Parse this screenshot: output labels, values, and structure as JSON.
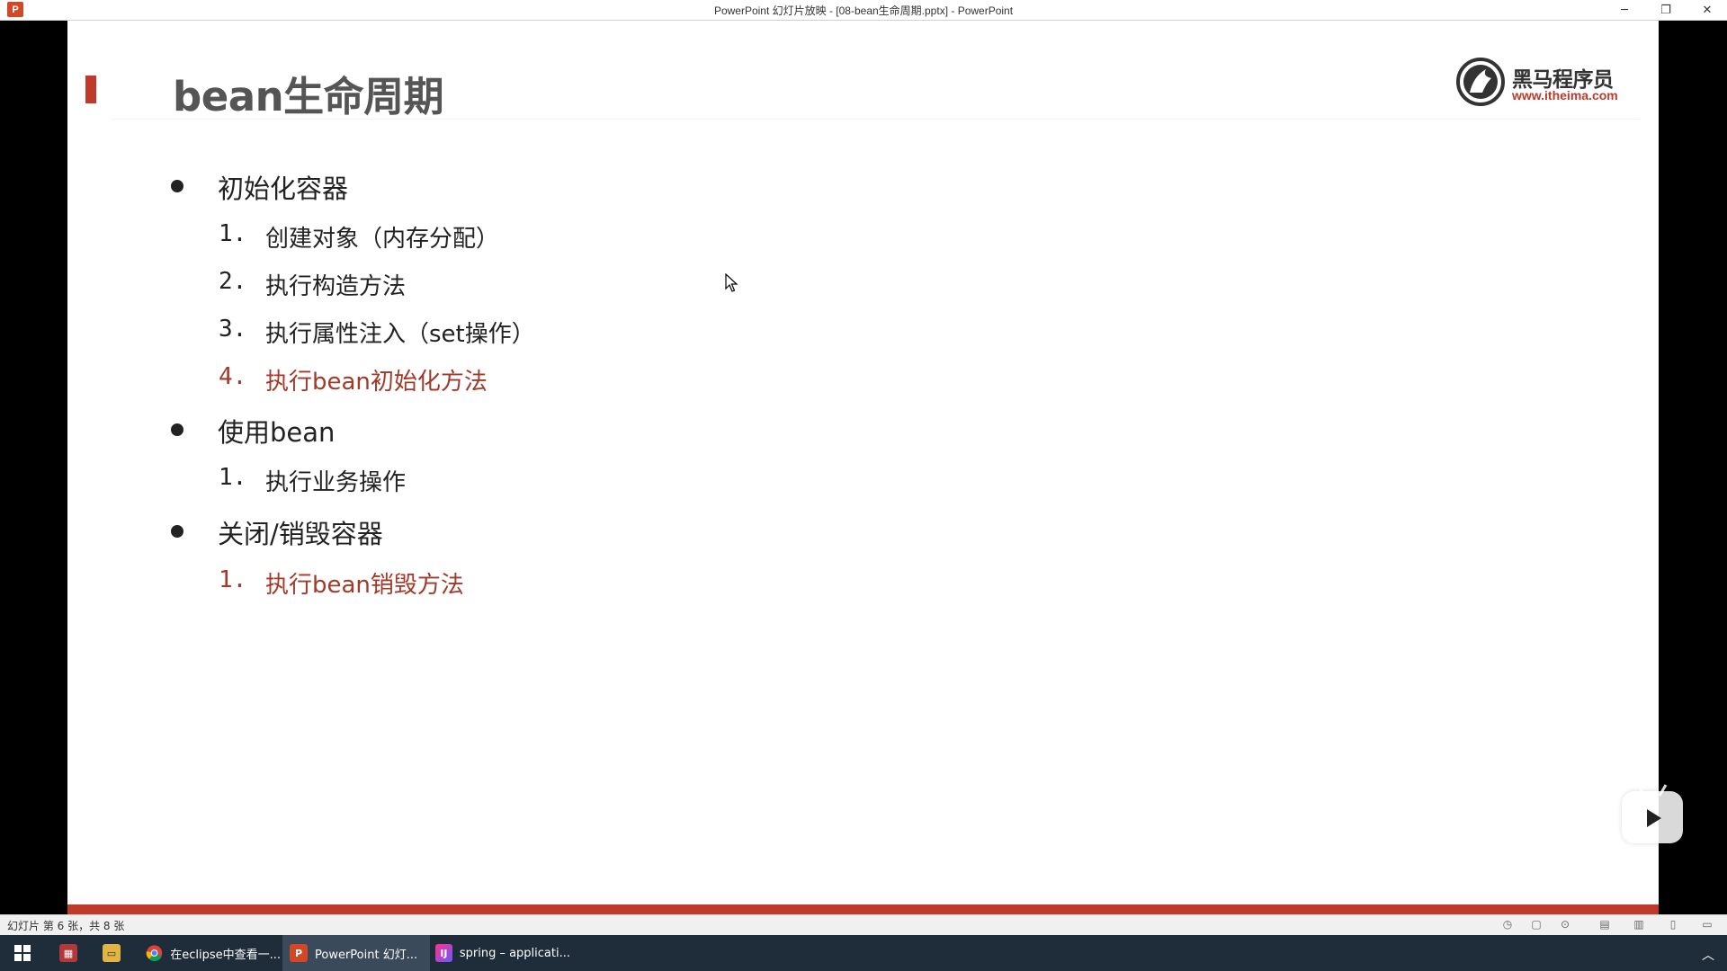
{
  "window": {
    "app_icon": "P",
    "title": "PowerPoint 幻灯片放映 - [08-bean生命周期.pptx] - PowerPoint",
    "buttons": {
      "minimize": "─",
      "restore": "❐",
      "close": "✕"
    }
  },
  "slide": {
    "title": "bean生命周期",
    "logo": {
      "brand": "黑马程序员",
      "url": "www.itheima.com"
    },
    "sections": [
      {
        "label": "初始化容器",
        "steps": [
          {
            "num": "1.",
            "text": "创建对象（内存分配）"
          },
          {
            "num": "2.",
            "text": "执行构造方法"
          },
          {
            "num": "3.",
            "text": "执行属性注入（set操作）"
          },
          {
            "num": "4.",
            "text": "执行bean初始化方法"
          }
        ]
      },
      {
        "label": "使用bean",
        "steps": [
          {
            "num": "1.",
            "text": "执行业务操作"
          }
        ]
      },
      {
        "label": "关闭/销毁容器",
        "steps": [
          {
            "num": "1.",
            "text": "执行bean销毁方法"
          }
        ]
      }
    ]
  },
  "statusbar": {
    "text": "幻灯片 第 6 张，共 8 张"
  },
  "taskbar": {
    "items": [
      {
        "label": "在eclipse中查看一..."
      },
      {
        "label": "PowerPoint 幻灯..."
      },
      {
        "label": "spring – applicati..."
      }
    ]
  },
  "colors": {
    "accent_red": "#c0392b",
    "highlight_text": "#a23a2a",
    "title_gray": "#555555",
    "taskbar": "#1f2d3a"
  }
}
